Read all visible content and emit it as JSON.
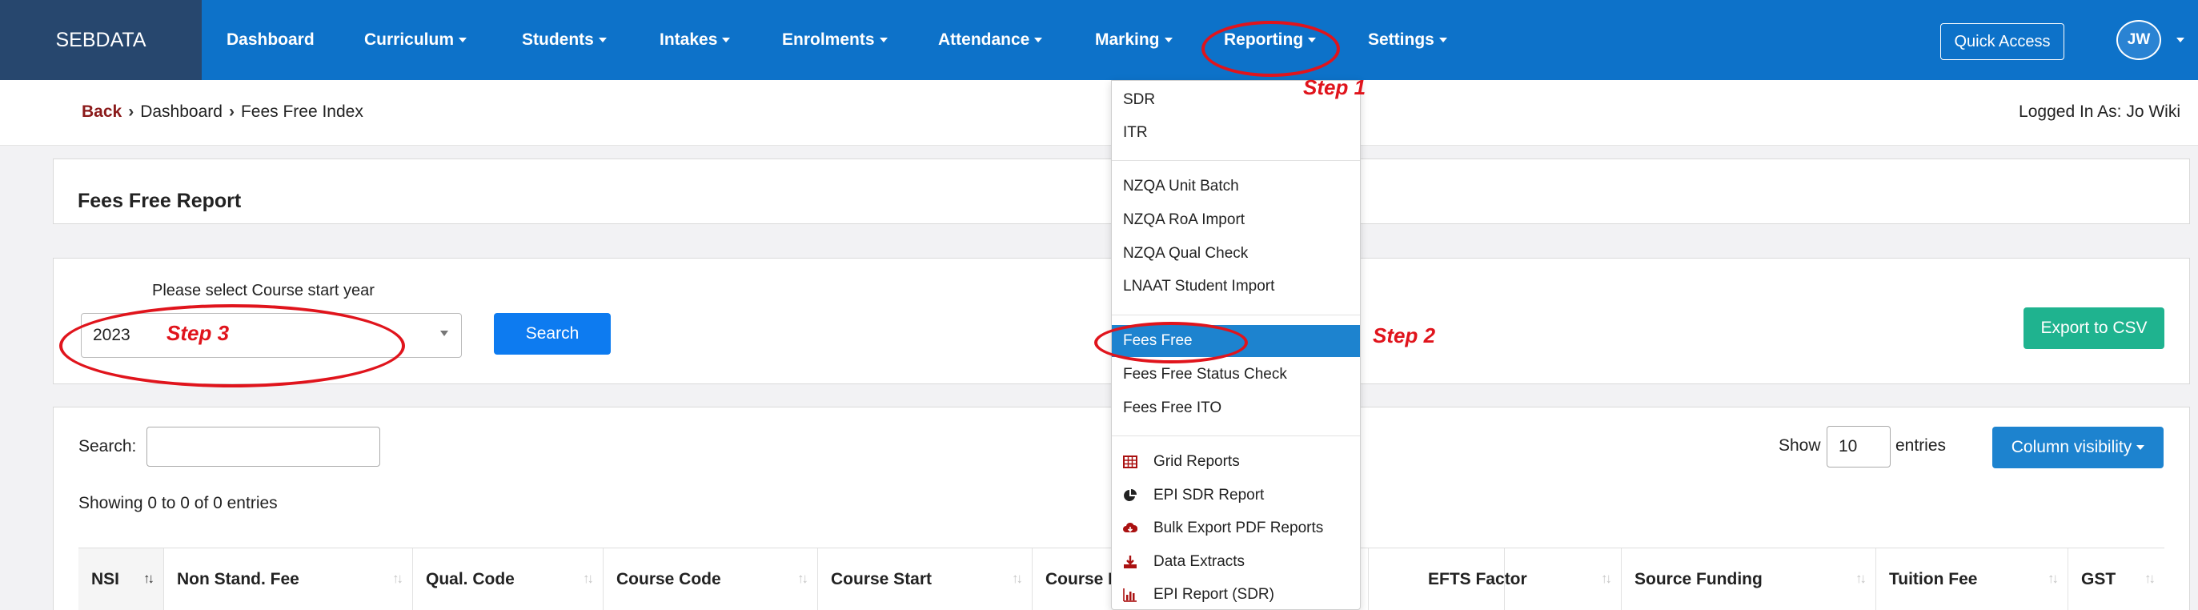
{
  "navbar": {
    "brand": "SEBDATA",
    "items": [
      {
        "label": "Dashboard",
        "caret": false
      },
      {
        "label": "Curriculum",
        "caret": true
      },
      {
        "label": "Students",
        "caret": true
      },
      {
        "label": "Intakes",
        "caret": true
      },
      {
        "label": "Enrolments",
        "caret": true
      },
      {
        "label": "Attendance",
        "caret": true
      },
      {
        "label": "Marking",
        "caret": true
      },
      {
        "label": "Reporting",
        "caret": true
      },
      {
        "label": "Settings",
        "caret": true
      }
    ],
    "quick_access": "Quick Access",
    "avatar_initials": "JW"
  },
  "breadcrumb": {
    "back": "Back",
    "items": [
      "Dashboard",
      "Fees Free Index"
    ]
  },
  "logged_in": "Logged In As: Jo Wiki",
  "report": {
    "title": "Fees Free Report"
  },
  "filter": {
    "label": "Please select Course start year",
    "year_value": "2023",
    "search_button": "Search",
    "export_button": "Export to CSV"
  },
  "table_controls": {
    "search_label": "Search:",
    "search_value": "",
    "show_label": "Show",
    "entries_value": "10",
    "entries_label": "entries",
    "column_visibility": "Column visibility",
    "showing_text": "Showing 0 to 0 of 0 entries"
  },
  "table": {
    "columns": [
      "NSI",
      "Non Stand. Fee",
      "Qual. Code",
      "Course Code",
      "Course Start",
      "Course E",
      "",
      "EFTS Factor",
      "Source Funding",
      "Tuition Fee",
      "GST"
    ],
    "sorted_column": "NSI"
  },
  "dropdown": {
    "groups": [
      [
        {
          "label": "SDR",
          "icon": ""
        },
        {
          "label": "ITR",
          "icon": ""
        }
      ],
      [
        {
          "label": "NZQA Unit Batch",
          "icon": ""
        },
        {
          "label": "NZQA RoA Import",
          "icon": ""
        },
        {
          "label": "NZQA Qual Check",
          "icon": ""
        },
        {
          "label": "LNAAT Student Import",
          "icon": ""
        }
      ],
      [
        {
          "label": "Fees Free",
          "icon": "",
          "active": true
        },
        {
          "label": "Fees Free Status Check",
          "icon": ""
        },
        {
          "label": "Fees Free ITO",
          "icon": ""
        }
      ],
      [
        {
          "label": "Grid Reports",
          "icon": "table-grid-icon"
        },
        {
          "label": "EPI SDR Report",
          "icon": "pie-chart-icon"
        },
        {
          "label": "Bulk Export PDF Reports",
          "icon": "cloud-download-icon"
        },
        {
          "label": "Data Extracts",
          "icon": "download-icon"
        },
        {
          "label": "EPI Report (SDR)",
          "icon": "bar-chart-icon"
        }
      ]
    ]
  },
  "annotations": {
    "step1": "Step 1",
    "step2": "Step 2",
    "step3": "Step 3",
    "color": "#e0141c"
  },
  "colors": {
    "navbar": "#0d72c9",
    "brand_bg": "#27476e",
    "search_button": "#0d7bf0",
    "export_button": "#1fb38f",
    "active_menu": "#1d83cf",
    "back_link": "#8b1a1a"
  }
}
